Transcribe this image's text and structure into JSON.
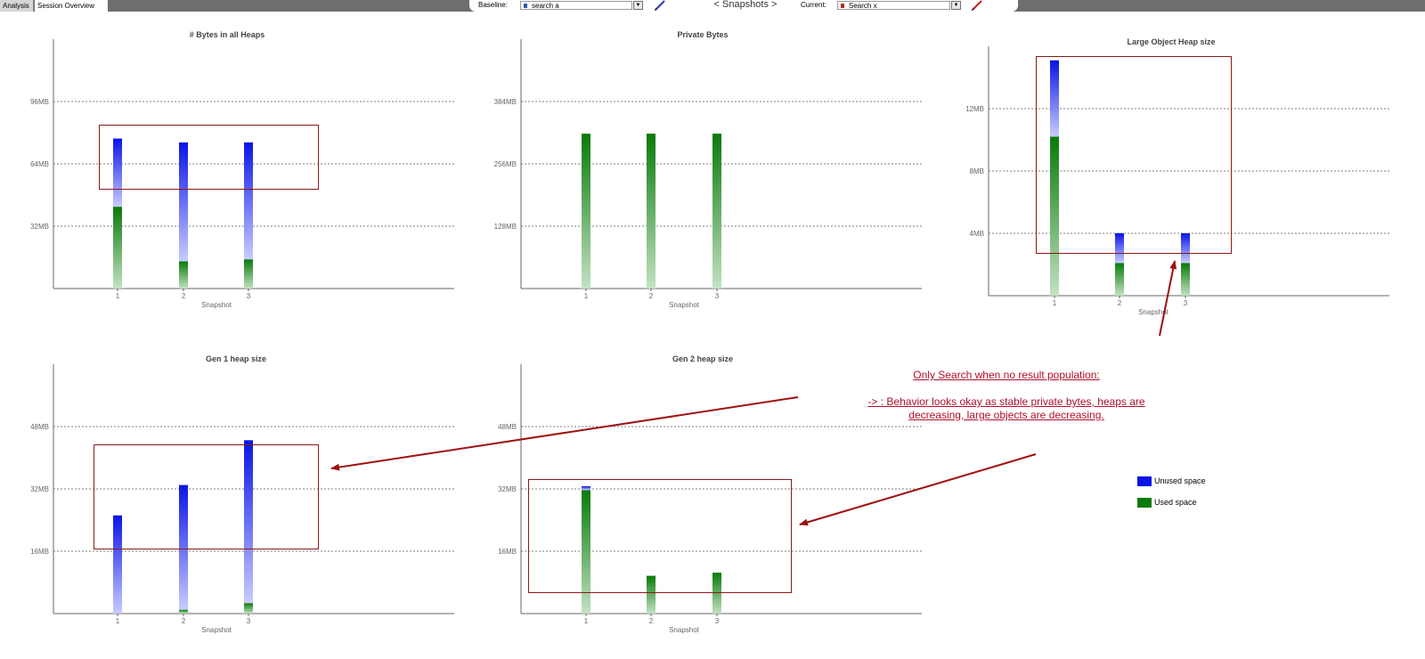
{
  "toolbar": {
    "tab_analysis": "Analysis",
    "tab_session_overview": "Session Overview",
    "baseline_label": "Baseline:",
    "baseline_value": "search a",
    "baseline_color": "#2a5ab4",
    "snapshots_nav": "< Snapshots >",
    "current_label": "Current:",
    "current_value": "Search x",
    "current_color": "#b42a2a"
  },
  "colors": {
    "unused_dark": "#0a14e6",
    "unused_light": "#c8ccff",
    "used_dark": "#0a7a0a",
    "used_light": "#c2e2c2",
    "annotation": "#b0102a",
    "box": "#8b1a1a"
  },
  "annotation": {
    "line1": "Only Search when no result population:",
    "line2": "-> :  Behavior looks okay as stable private bytes, heaps are",
    "line3": "decreasing, large objects are decreasing."
  },
  "legend": {
    "unused": "Unused space",
    "used": "Used space"
  },
  "chart_data": [
    {
      "type": "bar",
      "title": "# Bytes in all Heaps",
      "xlabel": "Snapshot",
      "categories": [
        "1",
        "2",
        "3"
      ],
      "ylim": [
        0,
        128
      ],
      "yticks": [
        32,
        64,
        96
      ],
      "ytick_labels": [
        "32MB",
        "64MB",
        "96MB"
      ],
      "grid": true,
      "series": [
        {
          "name": "Used space",
          "values": [
            42,
            14,
            15
          ]
        },
        {
          "name": "Unused space",
          "values": [
            35,
            61,
            60
          ]
        }
      ]
    },
    {
      "type": "bar",
      "title": "Private Bytes",
      "xlabel": "Snapshot",
      "categories": [
        "1",
        "2",
        "3"
      ],
      "ylim": [
        0,
        512
      ],
      "yticks": [
        128,
        256,
        384
      ],
      "ytick_labels": [
        "128MB",
        "256MB",
        "384MB"
      ],
      "grid": true,
      "series": [
        {
          "name": "Used space",
          "values": [
            318,
            318,
            318
          ]
        },
        {
          "name": "Unused space",
          "values": [
            0,
            0,
            0
          ]
        }
      ]
    },
    {
      "type": "bar",
      "title": "Large Object Heap size",
      "xlabel": "Snapshot",
      "categories": [
        "1",
        "2",
        "3"
      ],
      "ylim": [
        0,
        16
      ],
      "yticks": [
        4,
        8,
        12
      ],
      "ytick_labels": [
        "4MB",
        "8MB",
        "12MB"
      ],
      "grid": true,
      "series": [
        {
          "name": "Used space",
          "values": [
            10.2,
            2.1,
            2.1
          ]
        },
        {
          "name": "Unused space",
          "values": [
            4.9,
            1.9,
            1.9
          ]
        }
      ]
    },
    {
      "type": "bar",
      "title": "Gen 1 heap size",
      "xlabel": "Snapshot",
      "categories": [
        "1",
        "2",
        "3"
      ],
      "ylim": [
        0,
        64
      ],
      "yticks": [
        16,
        32,
        48
      ],
      "ytick_labels": [
        "16MB",
        "32MB",
        "48MB"
      ],
      "grid": true,
      "series": [
        {
          "name": "Used space",
          "values": [
            0,
            1,
            2.7
          ]
        },
        {
          "name": "Unused space",
          "values": [
            25.2,
            32,
            41.8
          ]
        }
      ]
    },
    {
      "type": "bar",
      "title": "Gen 2 heap size",
      "xlabel": "Snapshot",
      "categories": [
        "1",
        "2",
        "3"
      ],
      "ylim": [
        0,
        64
      ],
      "yticks": [
        16,
        32,
        48
      ],
      "ytick_labels": [
        "16MB",
        "32MB",
        "48MB"
      ],
      "grid": true,
      "series": [
        {
          "name": "Used space",
          "values": [
            31.7,
            9.7,
            10.5
          ]
        },
        {
          "name": "Unused space",
          "values": [
            1,
            0,
            0
          ]
        }
      ]
    }
  ]
}
